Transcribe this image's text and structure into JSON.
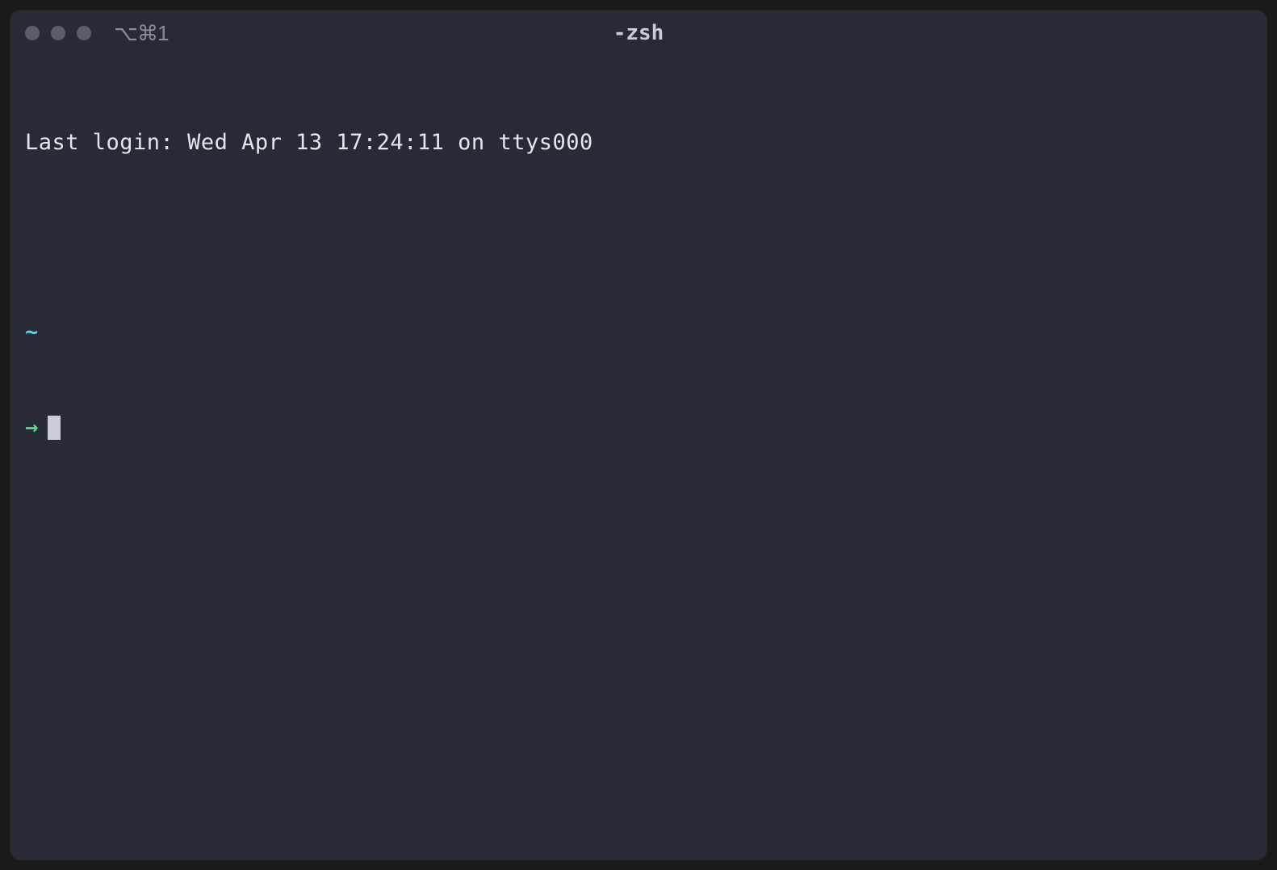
{
  "window": {
    "title": "-zsh",
    "tab_indicator": "⌥⌘1"
  },
  "terminal": {
    "login_message": "Last login: Wed Apr 13 17:24:11 on ttys000",
    "prompt_path": "~",
    "prompt_arrow": "→",
    "current_input": ""
  },
  "colors": {
    "background": "#282a36",
    "foreground": "#e4e6ed",
    "path_color": "#5dd6e8",
    "arrow_color": "#4ade80",
    "traffic_light_inactive": "#5a5d6b",
    "cursor": "#c9ccda"
  }
}
